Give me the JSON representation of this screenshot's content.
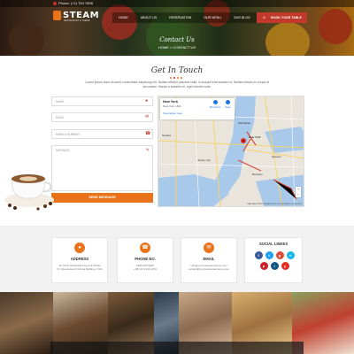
{
  "topbar": {
    "phone": "Phone: (+1) 754 7898"
  },
  "brand": {
    "name": "STEAM",
    "tagline": "RESTAURANT & THEME"
  },
  "nav": {
    "items": [
      "HOME",
      "ABOUT US",
      "RESERVATION",
      "OUR MENU",
      "OUR BLOG",
      "CONTACT US"
    ],
    "booking": "BOOK YOUR TABLE"
  },
  "hero": {
    "title": "Contact Us",
    "breadcrumb": "HOME  >  CONTACT US"
  },
  "contact": {
    "title": "Get In Touch",
    "lead": "Lorem ipsum dolor sit amet consectetur adipiscing elit. Nullam efficitur placerat nulla, in suscipit erat sodales id. Nullam ultrices eu turpis at accumsan. Mauris a sodales mi, eget lobortis nulla.",
    "fields": {
      "name": "NAME",
      "email": "EMAIL",
      "phone": "MOBILE NUMBER",
      "message": "MESSAGE"
    },
    "send": "SEND MESSAGE"
  },
  "map": {
    "place": "New York",
    "subtitle": "New York, USA",
    "larger": "View larger map",
    "directions": "Directions",
    "save": "Save",
    "labels": [
      "New York",
      "Newark",
      "Jersey City",
      "Brooklyn",
      "Manhattan",
      "Queens"
    ],
    "footer": "Map data ©2017 Google   Terms of Use   Report a map error"
  },
  "info": {
    "address": {
      "title": "ADDRESS",
      "line1": "20, River Restaurant Food & Drinks",
      "line2": "Nr. Queensland Victoria Building, USA"
    },
    "phone": {
      "title": "PHONE NO.",
      "line1": "1800 000 0000",
      "line2": "+98 123 1234 1234"
    },
    "email": {
      "title": "EMAIL",
      "line1": "info@yourrestaurantname.com",
      "line2": "contact@yourrestaurantname.com"
    },
    "social": {
      "title": "SOCIAL LINKES",
      "icons": [
        "facebook-icon",
        "twitter-icon",
        "google-plus-icon",
        "vimeo-icon",
        "pinterest-icon",
        "instagram-icon",
        "youtube-icon"
      ]
    }
  },
  "colors": {
    "accent": "#e8731a",
    "red": "#c0392b"
  }
}
